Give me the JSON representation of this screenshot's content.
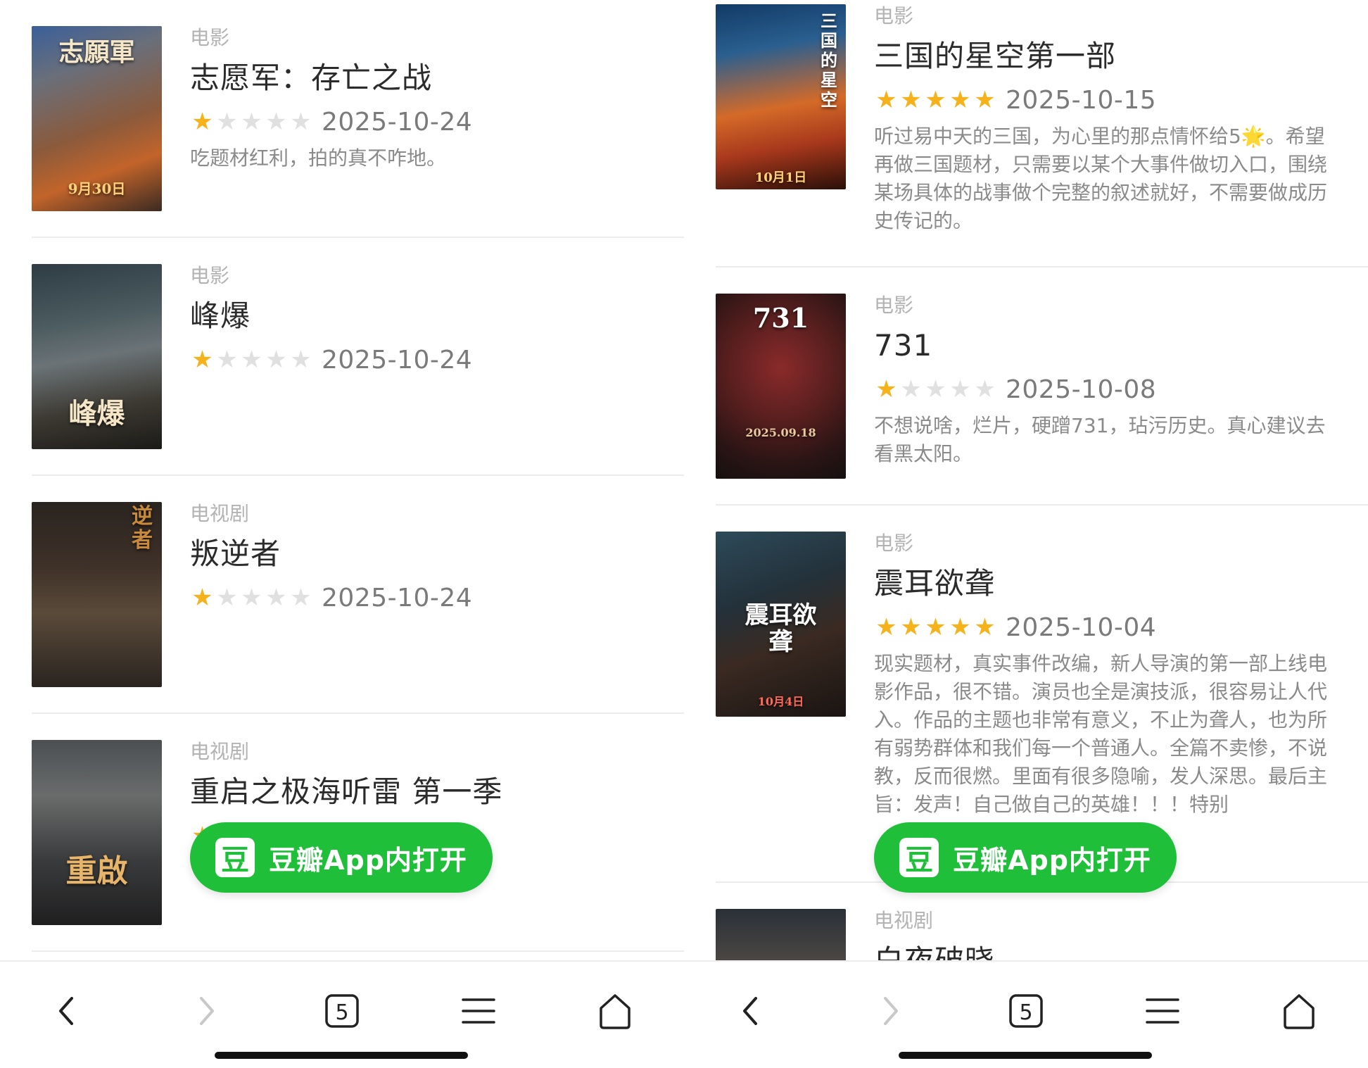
{
  "left": {
    "items": [
      {
        "type": "电影",
        "title": "志愿军：存亡之战",
        "rating": 1,
        "date": "2025-10-24",
        "comment": "吃题材红利，拍的真不咋地。",
        "poster_text": "志願軍",
        "poster_sub": "9月30日"
      },
      {
        "type": "电影",
        "title": "峰爆",
        "rating": 1,
        "date": "2025-10-24",
        "comment": "",
        "poster_text": "峰爆",
        "poster_sub": ""
      },
      {
        "type": "电视剧",
        "title": "叛逆者",
        "rating": 1,
        "date": "2025-10-24",
        "comment": "",
        "poster_text": "逆者",
        "poster_sub": ""
      },
      {
        "type": "电视剧",
        "title": "重启之极海听雷 第一季",
        "rating": 1,
        "date": "",
        "comment": "",
        "poster_text": "重啟",
        "poster_sub": ""
      }
    ]
  },
  "right": {
    "items": [
      {
        "type": "电影",
        "title": "三国的星空第一部",
        "rating": 5,
        "date": "2025-10-15",
        "comment": "听过易中天的三国，为心里的那点情怀给5🌟。希望再做三国题材，只需要以某个大事件做切入口，围绕某场具体的战事做个完整的叙述就好，不需要做成历史传记的。",
        "poster_text": "三国的星空",
        "poster_sub": "10月1日"
      },
      {
        "type": "电影",
        "title": "731",
        "rating": 1,
        "date": "2025-10-08",
        "comment": "不想说啥，烂片，硬蹭731，玷污历史。真心建议去看黑太阳。",
        "poster_text": "731",
        "poster_sub": "2025.09.18"
      },
      {
        "type": "电影",
        "title": "震耳欲聋",
        "rating": 5,
        "date": "2025-10-04",
        "comment": "现实题材，真实事件改编，新人导演的第一部上线电影作品，很不错。演员也全是演技派，很容易让人代入。作品的主题也非常有意义，不止为聋人，也为所有弱势群体和我们每一个普通人。全篇不卖惨，不说教，反而很燃。里面有很多隐喻，发人深思。最后主旨：发声！自己做自己的英雄！！！特别",
        "poster_text": "震耳欲聋",
        "poster_sub": "10月4日"
      },
      {
        "type": "电视剧",
        "title": "白夜破晓",
        "rating": 0,
        "date": "",
        "comment": "",
        "poster_text": "",
        "poster_sub": ""
      }
    ]
  },
  "open_app": {
    "logo": "豆",
    "label": "豆瓣App内打开"
  },
  "toolbar": {
    "tabs_count": "5"
  },
  "colors": {
    "accent": "#1fbf3a",
    "star_on": "#f6b21a",
    "star_off": "#e0e0e0"
  }
}
